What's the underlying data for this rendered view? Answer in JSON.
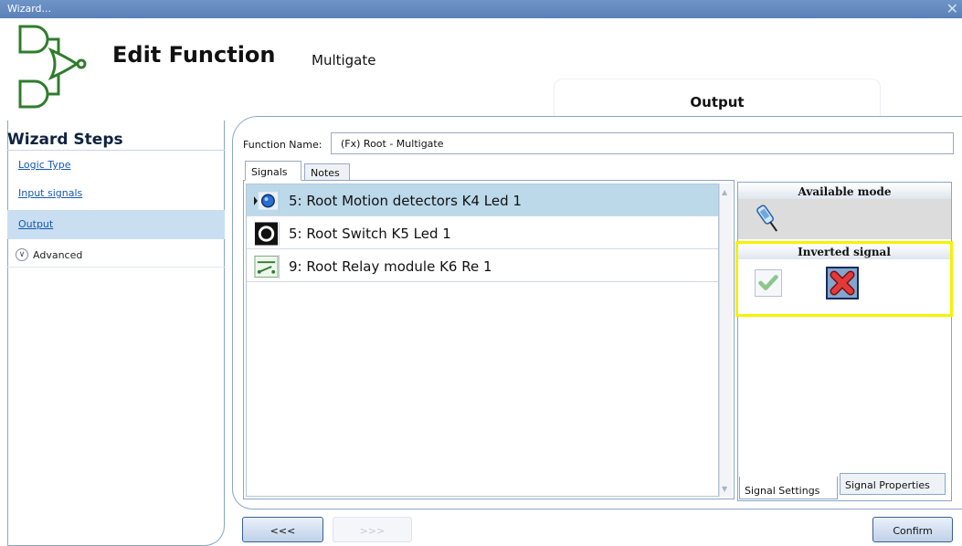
{
  "window": {
    "title": "Wizard...",
    "close_glyph": "✕"
  },
  "header": {
    "title": "Edit Function",
    "subtitle": "Multigate",
    "step_tab": "Output",
    "logo_icon": "logic-gate-icon"
  },
  "sidebar": {
    "title": "Wizard Steps",
    "items": [
      {
        "label": "Logic Type",
        "active": false
      },
      {
        "label": "Input signals",
        "active": false
      },
      {
        "label": "Output",
        "active": true
      },
      {
        "label": "Advanced",
        "icon": "chevron-down-icon"
      }
    ]
  },
  "function_name": {
    "label": "Function Name:",
    "value": "(Fx) Root - Multigate"
  },
  "tabs": {
    "signals": "Signals",
    "notes": "Notes"
  },
  "signals": [
    {
      "text": "5: Root Motion detectors K4 Led 1",
      "icon": "motion-detector-icon",
      "selected": true
    },
    {
      "text": "5: Root Switch K5 Led 1",
      "icon": "switch-icon",
      "selected": false
    },
    {
      "text": "9: Root Relay module K6 Re 1",
      "icon": "relay-icon",
      "selected": false
    }
  ],
  "settings": {
    "available_mode": "Available mode",
    "inverted_signal": "Inverted signal",
    "mode_icon": "probe-icon",
    "ok_icon": "checkmark-icon",
    "no_icon": "red-x-icon",
    "highlight_color": "#f4f200"
  },
  "bottom_tabs": {
    "settings": "Signal Settings",
    "properties": "Signal Properties"
  },
  "nav": {
    "back": "<<<",
    "next": ">>>",
    "confirm": "Confirm"
  }
}
